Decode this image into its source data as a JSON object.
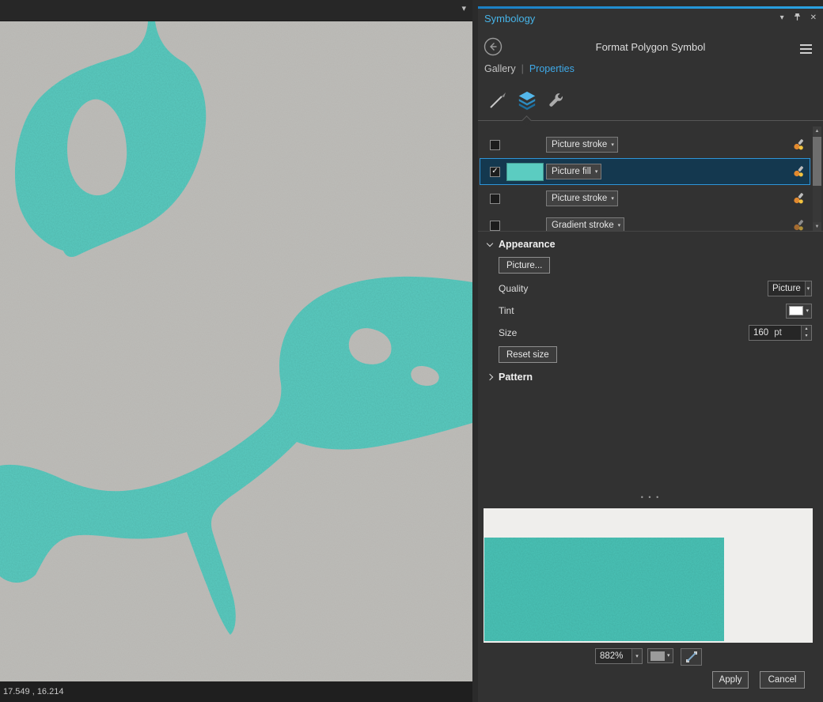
{
  "colors": {
    "teal": "#5bccc1",
    "preview_teal": "#4cc4b8",
    "map_bg": "#bdbcb8",
    "accent_blue": "#2e94d8",
    "panel_title_blue": "#47b4e8",
    "tint_color": "#ffffff",
    "preview_bg_color": "#9b9b9b"
  },
  "icons": {
    "dropdown_arrow": "▾",
    "collapse_arrow": "▾",
    "close": "✕",
    "check": "✓",
    "scroll_up": "▲",
    "scroll_down": "▼",
    "spin_up": "▴",
    "spin_down": "▾",
    "splitter_dots": "• • •"
  },
  "map": {
    "statusbar": {
      "coordinates": "17.549 , 16.214"
    }
  },
  "panel": {
    "title": "Symbology",
    "header": {
      "title": "Format Polygon Symbol"
    },
    "tabs": {
      "gallery": "Gallery",
      "separator": "|",
      "properties": "Properties"
    },
    "layers": [
      {
        "label": "Picture stroke",
        "checked": false,
        "selected": false
      },
      {
        "label": "Picture fill",
        "checked": true,
        "selected": true
      },
      {
        "label": "Picture stroke",
        "checked": false,
        "selected": false
      },
      {
        "label": "Gradient stroke",
        "checked": false,
        "selected": false
      }
    ],
    "appearance": {
      "header": "Appearance",
      "picture_button": "Picture...",
      "quality_label": "Quality",
      "quality_value": "Picture",
      "tint_label": "Tint",
      "size_label": "Size",
      "size_value": "160",
      "size_unit": "pt",
      "reset_button": "Reset size"
    },
    "pattern": {
      "header": "Pattern"
    },
    "preview": {
      "zoom": "882%"
    },
    "actions": {
      "apply": "Apply",
      "cancel": "Cancel"
    }
  }
}
